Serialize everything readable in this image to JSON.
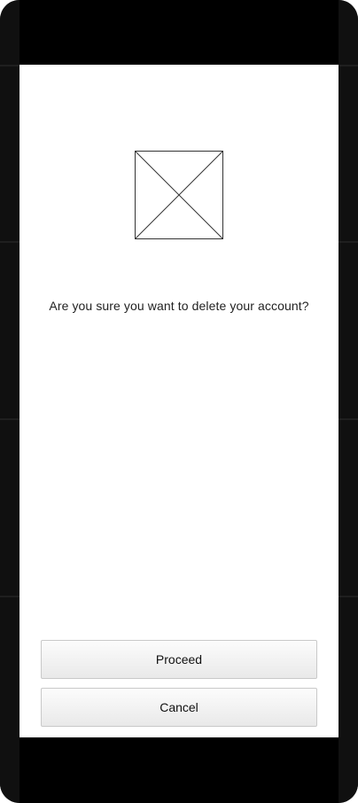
{
  "dialog": {
    "message": "Are you sure you want to delete your account?",
    "image_icon": "image-placeholder-icon"
  },
  "actions": {
    "proceed_label": "Proceed",
    "cancel_label": "Cancel"
  },
  "colors": {
    "bezel": "#000000",
    "frame": "#101010",
    "screen_bg": "#ffffff",
    "button_border": "#c9c9c9",
    "text": "#222222"
  }
}
